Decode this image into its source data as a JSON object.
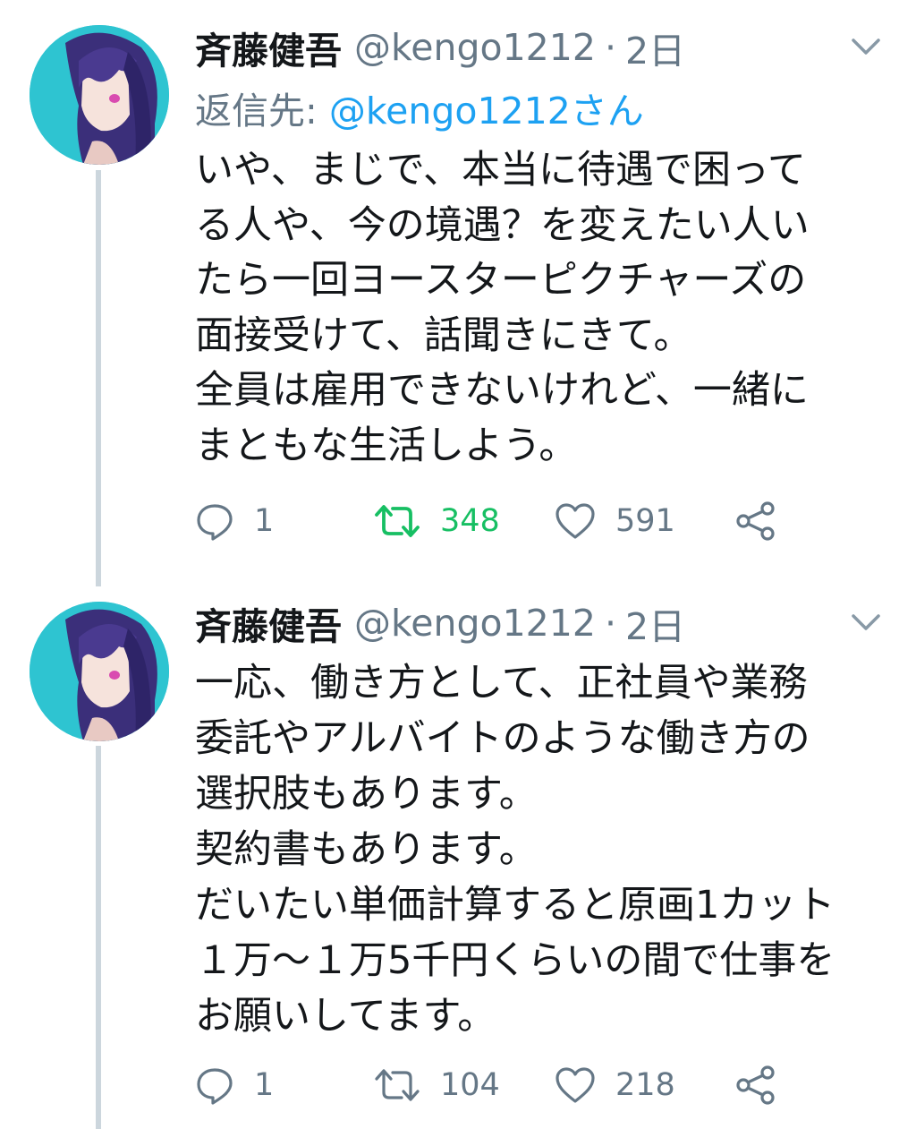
{
  "tweets": [
    {
      "name": "斉藤健吾",
      "handle": "@kengo1212",
      "separator": "·",
      "time": "2日",
      "reply_label": "返信先: ",
      "reply_mention": "@kengo1212さん",
      "lines": [
        "いや、まじで、本当に待遇で困って",
        "る人や、今の境遇？を変えたい人い",
        "たら一回ヨースターピクチャーズの",
        "面接受けて、話聞きにきて。",
        "全員は雇用できないけれど、一緒に",
        "まともな生活しよう。"
      ],
      "replies": "1",
      "retweets": "348",
      "likes": "591",
      "retweeted": true,
      "retweet_color": "#17bf63"
    },
    {
      "name": "斉藤健吾",
      "handle": "@kengo1212",
      "separator": "·",
      "time": "2日",
      "lines": [
        "一応、働き方として、正社員や業務",
        "委託やアルバイトのような働き方の",
        "選択肢もあります。",
        "契約書もあります。",
        "だいたい単価計算すると原画1カット",
        "１万〜１万5千円くらいの間で仕事を",
        "お願いしてます。"
      ],
      "replies": "1",
      "retweets": "104",
      "likes": "218",
      "retweeted": false
    }
  ],
  "icons": {
    "avatar": "avatar-anime-girl",
    "caret": "chevron-down-icon",
    "reply": "reply-bubble-icon",
    "retweet": "retweet-arrows-icon",
    "like": "heart-outline-icon",
    "share": "share-nodes-icon"
  },
  "colors": {
    "text": "#14171a",
    "muted": "#657786",
    "link": "#1da1f2",
    "thread_line": "#ccd6dd",
    "avatar_bg": "#2ec4d1"
  }
}
